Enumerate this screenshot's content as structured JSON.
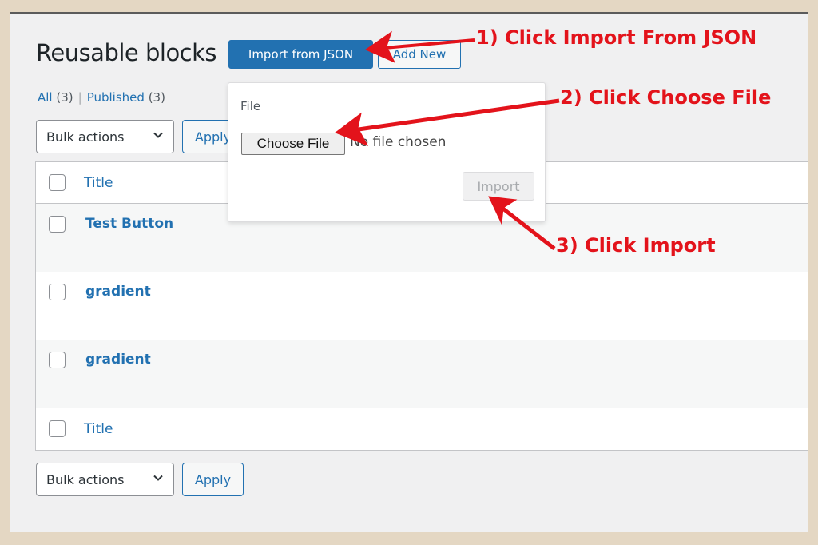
{
  "page": {
    "title": "Reusable blocks",
    "import_button": "Import from JSON",
    "add_new_button": "Add New"
  },
  "filters": {
    "all_label": "All",
    "all_count": "(3)",
    "separator": "|",
    "published_label": "Published",
    "published_count": "(3)"
  },
  "bulk_top": {
    "select_value": "Bulk actions",
    "apply_label": "Apply"
  },
  "bulk_bottom": {
    "select_value": "Bulk actions",
    "apply_label": "Apply"
  },
  "table": {
    "header_title": "Title",
    "footer_title": "Title",
    "rows": [
      {
        "title": "Test Button"
      },
      {
        "title": "gradient"
      },
      {
        "title": "gradient"
      }
    ]
  },
  "import_popover": {
    "field_label": "File",
    "choose_file_label": "Choose File",
    "no_file_text": "No file chosen",
    "import_label": "Import"
  },
  "annotations": {
    "step1": "1) Click Import From JSON",
    "step2": "2) Click Choose File",
    "step3": "3) Click Import",
    "color": "#e3131b"
  },
  "colors": {
    "accent": "#2271b1",
    "background_frame": "#e4d7c3",
    "panel": "#f0f0f1"
  }
}
